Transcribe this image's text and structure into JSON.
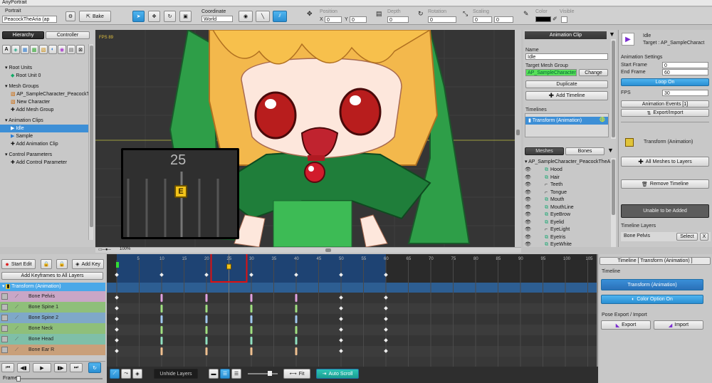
{
  "window": {
    "title": "AnyPortrait"
  },
  "toolbar": {
    "portrait_label": "Portrait",
    "portrait_name": "PeacockTheAria (ap",
    "bake": "Bake",
    "coordinate_label": "Coordinate",
    "coordinate_value": "World",
    "position": "Position",
    "depth": "Depth",
    "rotation": "Rotation",
    "scaling": "Scaling",
    "color": "Color",
    "visible": "Visible",
    "x": "X",
    "y": "Y",
    "zero": "0"
  },
  "left": {
    "tab_hierarchy": "Hierarchy",
    "tab_controller": "Controller",
    "sections": [
      {
        "title": "Root Units",
        "items": [
          "Root Unit 0"
        ]
      },
      {
        "title": "Mesh Groups",
        "items": [
          "AP_SampleCharacter_PeacockT",
          "New Character",
          "Add Mesh Group"
        ]
      },
      {
        "title": "Animation Clips",
        "items": [
          "Idle",
          "Sample",
          "Add Animation Clip"
        ]
      },
      {
        "title": "Control Parameters",
        "items": [
          "Add Control Parameter"
        ]
      }
    ]
  },
  "viewport": {
    "fps": "FPS 89",
    "zoom": "100%",
    "frame_popup": "25"
  },
  "anim_panel": {
    "header": "Animation Clip",
    "name_label": "Name",
    "name_value": "Idle",
    "target_label": "Target Mesh Group",
    "target_value": "AP_SampleCharacter_P",
    "change": "Change",
    "duplicate": "Duplicate",
    "add_timeline": "Add Timeline",
    "timelines_label": "Timelines",
    "timeline_item": "Transform (Animation)",
    "tab_meshes": "Meshes",
    "tab_bones": "Bones",
    "mesh_root": "AP_SampleCharacter_PeacockTheA",
    "meshes": [
      "Hood",
      "Hair",
      "Teeth",
      "Tongue",
      "Mouth",
      "MouthLine",
      "EyeBrow",
      "Eyelid",
      "EyeLight",
      "EyeIris",
      "EyeWhite"
    ]
  },
  "props": {
    "title": "Idle",
    "target": "Target : AP_SampleCharact",
    "settings": "Animation Settings",
    "start_label": "Start Frame",
    "start_value": "0",
    "end_label": "End Frame",
    "end_value": "60",
    "loop": "Loop On",
    "fps_label": "FPS",
    "fps_value": "30",
    "events": "Animation Events [1]",
    "export_import": "Export/Import",
    "transform": "Transform (Animation)",
    "all_meshes": "All Meshes to Layers",
    "remove_timeline": "Remove Timeline",
    "unable": "Unable to be Added",
    "timeline_layers": "Timeline Layers",
    "bone_pelvis": "Bone Pelvis",
    "select": "Select",
    "x": "X"
  },
  "timeline": {
    "start_edit": "Start Edit",
    "add_key": "Add Key",
    "add_all": "Add Keyframes to All Layers",
    "group": "Transform (Animation)",
    "layers": [
      {
        "name": "Bone Pelvis",
        "color": "#c9a6c6"
      },
      {
        "name": "Bone Spine 1",
        "color": "#8fbf7a"
      },
      {
        "name": "Bone Spine 2",
        "color": "#7fa8c8"
      },
      {
        "name": "Bone Neck",
        "color": "#8fbf7a"
      },
      {
        "name": "Bone Head",
        "color": "#7fbfa8"
      },
      {
        "name": "Bone Ear R",
        "color": "#c9a07a"
      }
    ],
    "ruler": [
      "5",
      "10",
      "15",
      "20",
      "25",
      "30",
      "35",
      "40",
      "45",
      "50",
      "55",
      "60",
      "65",
      "70",
      "75",
      "80",
      "85",
      "90",
      "95",
      "100",
      "105"
    ],
    "frame_label": "Frame",
    "unhide": "Unhide Layers",
    "fit": "Fit",
    "auto_scroll": "Auto Scroll"
  },
  "tl_right": {
    "title": "Timeline [ Transform (Animation) ]",
    "timeline_label": "Timeline",
    "transform": "Transform (Animation)",
    "color_option": "Color Option On",
    "pose_label": "Pose Export / Import",
    "export": "Export",
    "import": "Import"
  }
}
